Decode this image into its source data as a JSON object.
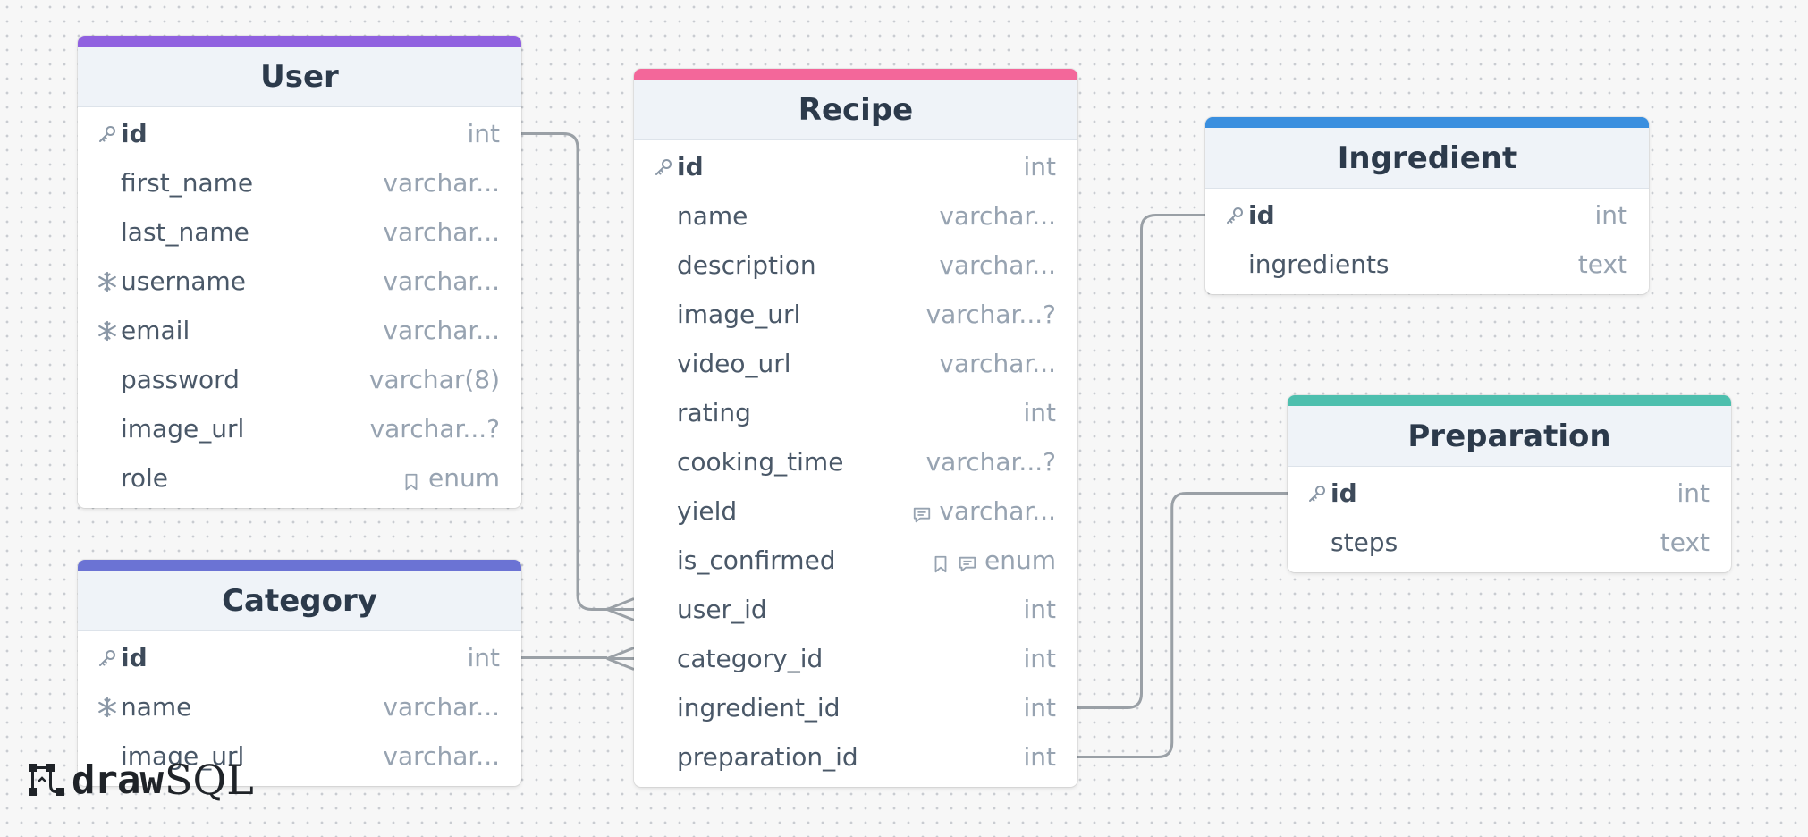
{
  "colors": {
    "user": "#9061e0",
    "category": "#6b73d4",
    "recipe": "#f3679a",
    "ingredient": "#3a8fdf",
    "preparation": "#4dbfae",
    "connector": "#9aa0a6"
  },
  "tables": {
    "user": {
      "name": "User",
      "fields": [
        {
          "name": "id",
          "type": "int",
          "icon": "key-icon",
          "pk": true
        },
        {
          "name": "first_name",
          "type": "varchar..."
        },
        {
          "name": "last_name",
          "type": "varchar..."
        },
        {
          "name": "username",
          "type": "varchar...",
          "icon": "unique-icon"
        },
        {
          "name": "email",
          "type": "varchar...",
          "icon": "unique-icon"
        },
        {
          "name": "password",
          "type": "varchar(8)"
        },
        {
          "name": "image_url",
          "type": "varchar...?"
        },
        {
          "name": "role",
          "type": "enum",
          "type_icons": [
            "bookmark-icon"
          ]
        }
      ]
    },
    "category": {
      "name": "Category",
      "fields": [
        {
          "name": "id",
          "type": "int",
          "icon": "key-icon",
          "pk": true
        },
        {
          "name": "name",
          "type": "varchar...",
          "icon": "unique-icon"
        },
        {
          "name": "image_url",
          "type": "varchar..."
        }
      ]
    },
    "recipe": {
      "name": "Recipe",
      "fields": [
        {
          "name": "id",
          "type": "int",
          "icon": "key-icon",
          "pk": true
        },
        {
          "name": "name",
          "type": "varchar..."
        },
        {
          "name": "description",
          "type": "varchar..."
        },
        {
          "name": "image_url",
          "type": "varchar...?"
        },
        {
          "name": "video_url",
          "type": "varchar..."
        },
        {
          "name": "rating",
          "type": "int"
        },
        {
          "name": "cooking_time",
          "type": "varchar...?"
        },
        {
          "name": "yield",
          "type": "varchar...",
          "type_icons": [
            "comment-icon"
          ]
        },
        {
          "name": "is_confirmed",
          "type": "enum",
          "type_icons": [
            "bookmark-icon",
            "comment-icon"
          ]
        },
        {
          "name": "user_id",
          "type": "int"
        },
        {
          "name": "category_id",
          "type": "int"
        },
        {
          "name": "ingredient_id",
          "type": "int"
        },
        {
          "name": "preparation_id",
          "type": "int"
        }
      ]
    },
    "ingredient": {
      "name": "Ingredient",
      "fields": [
        {
          "name": "id",
          "type": "int",
          "icon": "key-icon",
          "pk": true
        },
        {
          "name": "ingredients",
          "type": "text"
        }
      ]
    },
    "preparation": {
      "name": "Preparation",
      "fields": [
        {
          "name": "id",
          "type": "int",
          "icon": "key-icon",
          "pk": true
        },
        {
          "name": "steps",
          "type": "text"
        }
      ]
    }
  },
  "relations": [
    {
      "from": "user.id",
      "to": "recipe.user_id",
      "cardinality": "one-to-many"
    },
    {
      "from": "category.id",
      "to": "recipe.category_id",
      "cardinality": "one-to-many"
    },
    {
      "from": "recipe.ingredient_id",
      "to": "ingredient.id",
      "cardinality": "one-to-one"
    },
    {
      "from": "recipe.preparation_id",
      "to": "preparation.id",
      "cardinality": "one-to-one"
    }
  ],
  "branding": {
    "logo_part1": "draw",
    "logo_part2": "SQL",
    "logo_icon": "drawsql-logo-icon"
  }
}
